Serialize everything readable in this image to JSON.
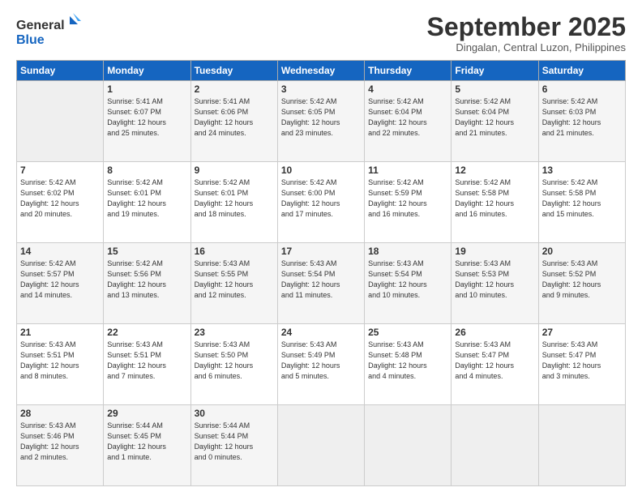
{
  "logo": {
    "line1": "General",
    "line2": "Blue"
  },
  "title": "September 2025",
  "location": "Dingalan, Central Luzon, Philippines",
  "weekdays": [
    "Sunday",
    "Monday",
    "Tuesday",
    "Wednesday",
    "Thursday",
    "Friday",
    "Saturday"
  ],
  "weeks": [
    [
      {
        "day": "",
        "info": ""
      },
      {
        "day": "1",
        "info": "Sunrise: 5:41 AM\nSunset: 6:07 PM\nDaylight: 12 hours\nand 25 minutes."
      },
      {
        "day": "2",
        "info": "Sunrise: 5:41 AM\nSunset: 6:06 PM\nDaylight: 12 hours\nand 24 minutes."
      },
      {
        "day": "3",
        "info": "Sunrise: 5:42 AM\nSunset: 6:05 PM\nDaylight: 12 hours\nand 23 minutes."
      },
      {
        "day": "4",
        "info": "Sunrise: 5:42 AM\nSunset: 6:04 PM\nDaylight: 12 hours\nand 22 minutes."
      },
      {
        "day": "5",
        "info": "Sunrise: 5:42 AM\nSunset: 6:04 PM\nDaylight: 12 hours\nand 21 minutes."
      },
      {
        "day": "6",
        "info": "Sunrise: 5:42 AM\nSunset: 6:03 PM\nDaylight: 12 hours\nand 21 minutes."
      }
    ],
    [
      {
        "day": "7",
        "info": "Sunrise: 5:42 AM\nSunset: 6:02 PM\nDaylight: 12 hours\nand 20 minutes."
      },
      {
        "day": "8",
        "info": "Sunrise: 5:42 AM\nSunset: 6:01 PM\nDaylight: 12 hours\nand 19 minutes."
      },
      {
        "day": "9",
        "info": "Sunrise: 5:42 AM\nSunset: 6:01 PM\nDaylight: 12 hours\nand 18 minutes."
      },
      {
        "day": "10",
        "info": "Sunrise: 5:42 AM\nSunset: 6:00 PM\nDaylight: 12 hours\nand 17 minutes."
      },
      {
        "day": "11",
        "info": "Sunrise: 5:42 AM\nSunset: 5:59 PM\nDaylight: 12 hours\nand 16 minutes."
      },
      {
        "day": "12",
        "info": "Sunrise: 5:42 AM\nSunset: 5:58 PM\nDaylight: 12 hours\nand 16 minutes."
      },
      {
        "day": "13",
        "info": "Sunrise: 5:42 AM\nSunset: 5:58 PM\nDaylight: 12 hours\nand 15 minutes."
      }
    ],
    [
      {
        "day": "14",
        "info": "Sunrise: 5:42 AM\nSunset: 5:57 PM\nDaylight: 12 hours\nand 14 minutes."
      },
      {
        "day": "15",
        "info": "Sunrise: 5:42 AM\nSunset: 5:56 PM\nDaylight: 12 hours\nand 13 minutes."
      },
      {
        "day": "16",
        "info": "Sunrise: 5:43 AM\nSunset: 5:55 PM\nDaylight: 12 hours\nand 12 minutes."
      },
      {
        "day": "17",
        "info": "Sunrise: 5:43 AM\nSunset: 5:54 PM\nDaylight: 12 hours\nand 11 minutes."
      },
      {
        "day": "18",
        "info": "Sunrise: 5:43 AM\nSunset: 5:54 PM\nDaylight: 12 hours\nand 10 minutes."
      },
      {
        "day": "19",
        "info": "Sunrise: 5:43 AM\nSunset: 5:53 PM\nDaylight: 12 hours\nand 10 minutes."
      },
      {
        "day": "20",
        "info": "Sunrise: 5:43 AM\nSunset: 5:52 PM\nDaylight: 12 hours\nand 9 minutes."
      }
    ],
    [
      {
        "day": "21",
        "info": "Sunrise: 5:43 AM\nSunset: 5:51 PM\nDaylight: 12 hours\nand 8 minutes."
      },
      {
        "day": "22",
        "info": "Sunrise: 5:43 AM\nSunset: 5:51 PM\nDaylight: 12 hours\nand 7 minutes."
      },
      {
        "day": "23",
        "info": "Sunrise: 5:43 AM\nSunset: 5:50 PM\nDaylight: 12 hours\nand 6 minutes."
      },
      {
        "day": "24",
        "info": "Sunrise: 5:43 AM\nSunset: 5:49 PM\nDaylight: 12 hours\nand 5 minutes."
      },
      {
        "day": "25",
        "info": "Sunrise: 5:43 AM\nSunset: 5:48 PM\nDaylight: 12 hours\nand 4 minutes."
      },
      {
        "day": "26",
        "info": "Sunrise: 5:43 AM\nSunset: 5:47 PM\nDaylight: 12 hours\nand 4 minutes."
      },
      {
        "day": "27",
        "info": "Sunrise: 5:43 AM\nSunset: 5:47 PM\nDaylight: 12 hours\nand 3 minutes."
      }
    ],
    [
      {
        "day": "28",
        "info": "Sunrise: 5:43 AM\nSunset: 5:46 PM\nDaylight: 12 hours\nand 2 minutes."
      },
      {
        "day": "29",
        "info": "Sunrise: 5:44 AM\nSunset: 5:45 PM\nDaylight: 12 hours\nand 1 minute."
      },
      {
        "day": "30",
        "info": "Sunrise: 5:44 AM\nSunset: 5:44 PM\nDaylight: 12 hours\nand 0 minutes."
      },
      {
        "day": "",
        "info": ""
      },
      {
        "day": "",
        "info": ""
      },
      {
        "day": "",
        "info": ""
      },
      {
        "day": "",
        "info": ""
      }
    ]
  ]
}
